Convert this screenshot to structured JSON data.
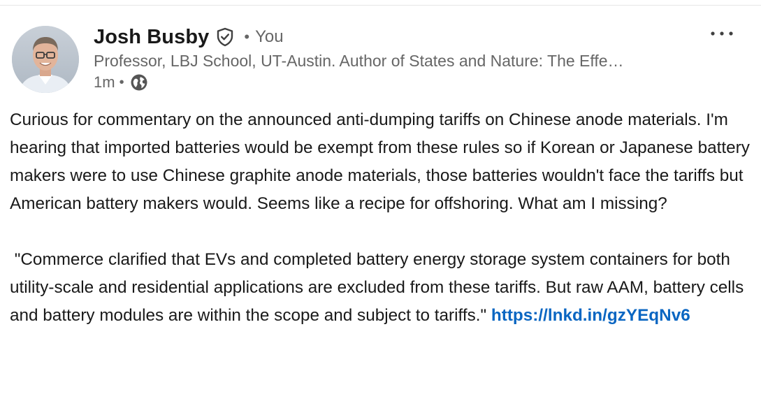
{
  "post": {
    "author": {
      "name": "Josh Busby",
      "relation": "You",
      "separator": "•",
      "headline": "Professor, LBJ School, UT-Austin. Author of States and Nature: The Effe…"
    },
    "meta": {
      "time": "1m",
      "separator": "•",
      "visibility_icon": "globe-icon"
    },
    "more_label": "•••",
    "body": {
      "paragraph1": "Curious for commentary on the announced anti-dumping tariffs on Chinese anode materials. I'm hearing that imported batteries would be exempt from these rules so if Korean or Japanese battery makers were to use Chinese graphite anode materials, those batteries wouldn't face the tariffs but American battery makers would. Seems like a recipe for offshoring. What am I missing?",
      "paragraph2": " \"Commerce clarified that EVs and completed battery energy storage system containers for both utility-scale and residential applications are excluded from these tariffs. But raw AAM, battery cells and battery modules are within the scope and subject to tariffs.\" ",
      "link_text": "https://lnkd.in/gzYEqNv6"
    }
  },
  "colors": {
    "text_primary": "#191919",
    "text_secondary": "#666666",
    "link": "#0a66c2"
  }
}
